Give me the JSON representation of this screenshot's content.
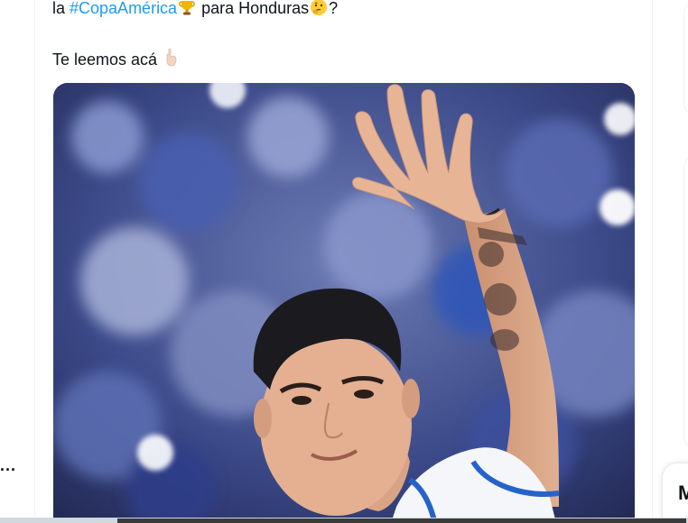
{
  "tweet": {
    "line1_prefix": "la ",
    "hashtag": "#CopaAmérica",
    "trophy_emoji": "trophy-emoji",
    "line1_middle": " para Honduras",
    "thinking_emoji": "thinking-face-emoji",
    "line1_suffix": "?",
    "line2_text": "Te leemos acá ",
    "pointing_emoji": "backhand-index-pointing-down-emoji"
  },
  "left": {
    "ellipsis": "..."
  },
  "right": {
    "card_letter": "M"
  },
  "colors": {
    "hashtag": "#1d9bf0",
    "text": "#0f1419",
    "border": "#eff3f4",
    "jersey_blue": "#2563c9"
  }
}
